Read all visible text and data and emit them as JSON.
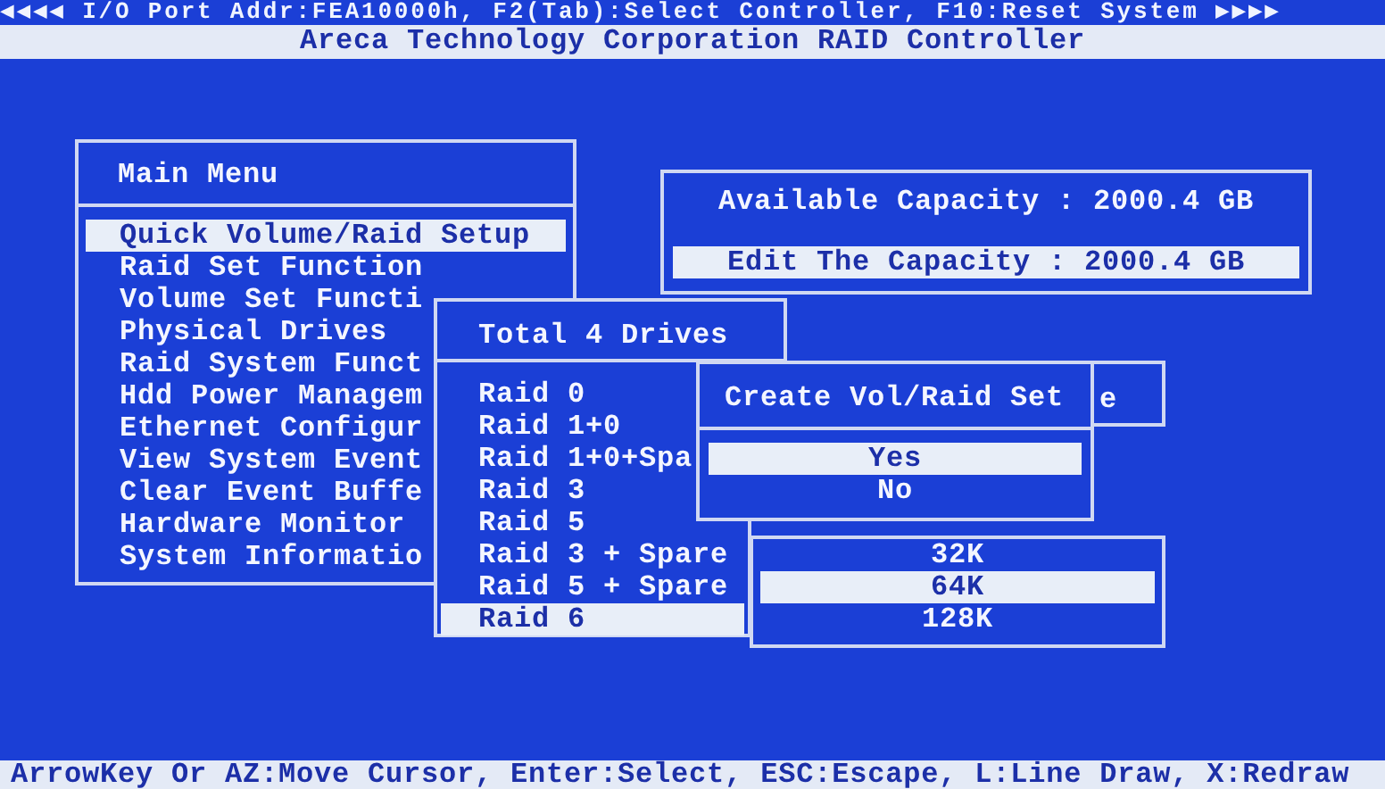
{
  "top_bar": "◀◀◀◀ I/O Port Addr:FEA10000h, F2(Tab):Select Controller, F10:Reset System ▶▶▶▶",
  "title_bar": "Areca Technology Corporation RAID Controller",
  "main_menu": {
    "title": "Main Menu",
    "items": [
      {
        "label": "Quick Volume/Raid Setup",
        "selected": true
      },
      {
        "label": "Raid Set Function",
        "selected": false
      },
      {
        "label": "Volume Set Functi",
        "selected": false
      },
      {
        "label": "Physical Drives",
        "selected": false
      },
      {
        "label": "Raid System Funct",
        "selected": false
      },
      {
        "label": "Hdd Power Managem",
        "selected": false
      },
      {
        "label": "Ethernet Configur",
        "selected": false
      },
      {
        "label": "View System Event",
        "selected": false
      },
      {
        "label": "Clear Event Buffe",
        "selected": false
      },
      {
        "label": "Hardware Monitor",
        "selected": false
      },
      {
        "label": "System Informatio",
        "selected": false
      }
    ]
  },
  "capacity": {
    "rows": [
      {
        "label": "Available Capacity : 2000.4 GB",
        "selected": false
      },
      {
        "label": "Edit The Capacity : 2000.4 GB",
        "selected": true
      }
    ]
  },
  "drives": {
    "title": "Total 4 Drives",
    "items": [
      {
        "label": "Raid 0",
        "selected": false
      },
      {
        "label": "Raid 1+0",
        "selected": false
      },
      {
        "label": "Raid 1+0+Spa",
        "selected": false
      },
      {
        "label": "Raid 3",
        "selected": false
      },
      {
        "label": "Raid 5",
        "selected": false
      },
      {
        "label": "Raid 3 + Spare",
        "selected": false
      },
      {
        "label": "Raid 5 + Spare",
        "selected": false
      },
      {
        "label": "Raid 6",
        "selected": true
      }
    ]
  },
  "covered_window": {
    "title": "e"
  },
  "confirm": {
    "title": "Create Vol/Raid Set",
    "options": [
      {
        "label": "Yes",
        "selected": true
      },
      {
        "label": "No",
        "selected": false
      }
    ]
  },
  "stripe_sizes": [
    {
      "label": "32K",
      "selected": false
    },
    {
      "label": "64K",
      "selected": true
    },
    {
      "label": "128K",
      "selected": false
    }
  ],
  "status_bar": "ArrowKey Or AZ:Move Cursor, Enter:Select, ESC:Escape, L:Line Draw, X:Redraw"
}
